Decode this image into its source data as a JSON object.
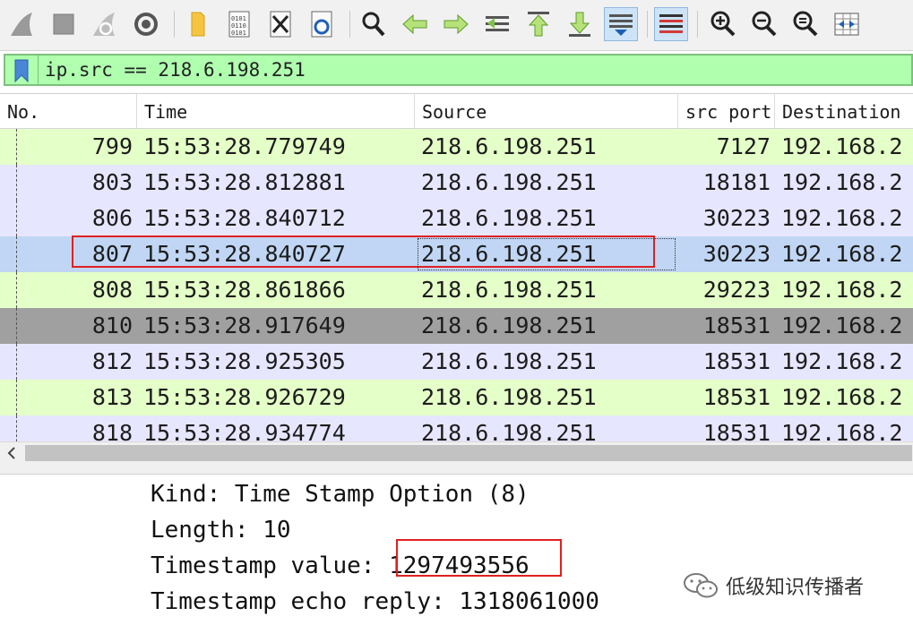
{
  "toolbar": {
    "items": [
      "start-capture",
      "stop-capture",
      "restart-capture",
      "capture-options",
      "open-file",
      "save-file",
      "close-file",
      "reload-file",
      "find-packet",
      "go-back",
      "go-forward",
      "go-to-packet",
      "go-first-packet",
      "go-last-packet",
      "auto-scroll",
      "colorize",
      "zoom-in",
      "zoom-out",
      "normal-size",
      "resize-columns"
    ]
  },
  "filter": {
    "value": "ip.src == 218.6.198.251"
  },
  "columns": [
    "No.",
    "Time",
    "Source",
    "src port",
    "Destination"
  ],
  "rows": [
    {
      "no": "799",
      "time": "15:53:28.779749",
      "src": "218.6.198.251",
      "port": "7127",
      "dst": "192.168.2",
      "bg": "#e4ffc7"
    },
    {
      "no": "803",
      "time": "15:53:28.812881",
      "src": "218.6.198.251",
      "port": "18181",
      "dst": "192.168.2",
      "bg": "#e7e6ff"
    },
    {
      "no": "806",
      "time": "15:53:28.840712",
      "src": "218.6.198.251",
      "port": "30223",
      "dst": "192.168.2",
      "bg": "#e7e6ff"
    },
    {
      "no": "807",
      "time": "15:53:28.840727",
      "src": "218.6.198.251",
      "port": "30223",
      "dst": "192.168.2",
      "bg": "#c0d6f4"
    },
    {
      "no": "808",
      "time": "15:53:28.861866",
      "src": "218.6.198.251",
      "port": "29223",
      "dst": "192.168.2",
      "bg": "#e4ffc7"
    },
    {
      "no": "810",
      "time": "15:53:28.917649",
      "src": "218.6.198.251",
      "port": "18531",
      "dst": "192.168.2",
      "bg": "#a0a0a0"
    },
    {
      "no": "812",
      "time": "15:53:28.925305",
      "src": "218.6.198.251",
      "port": "18531",
      "dst": "192.168.2",
      "bg": "#e7e6ff"
    },
    {
      "no": "813",
      "time": "15:53:28.926729",
      "src": "218.6.198.251",
      "port": "18531",
      "dst": "192.168.2",
      "bg": "#e4ffc7"
    },
    {
      "no": "818",
      "time": "15:53:28.934774",
      "src": "218.6.198.251",
      "port": "18531",
      "dst": "192.168.2",
      "bg": "#e7e6ff"
    }
  ],
  "details": {
    "kind": "Kind: Time Stamp Option (8)",
    "length": "Length: 10",
    "ts_label": "Timestamp value: ",
    "ts_value": "1297493556",
    "echo": "Timestamp echo reply: 1318061000"
  },
  "watermark": {
    "text": "低级知识传播者"
  },
  "colors": {
    "highlight": "#e02020",
    "filter_bg": "#afffaf",
    "selected_row": "#c0d6f4"
  }
}
